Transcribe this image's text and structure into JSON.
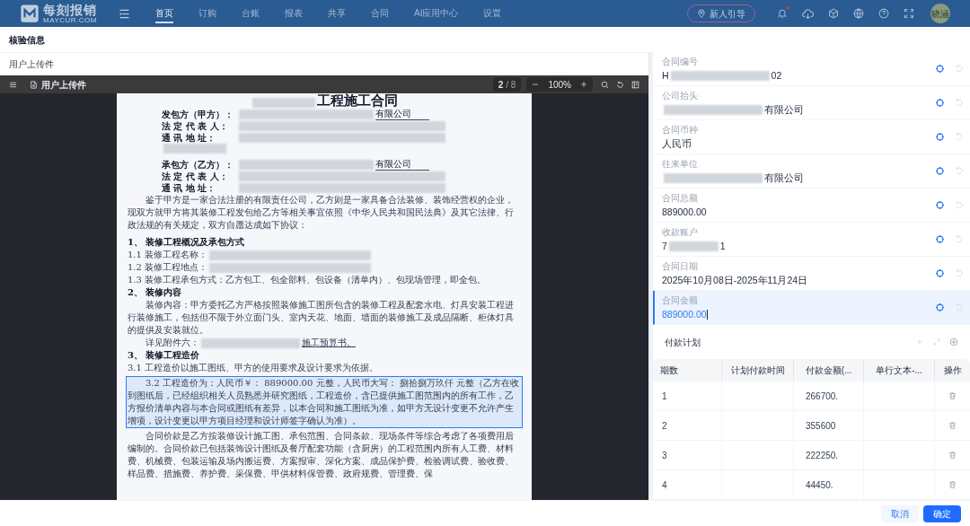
{
  "nav": {
    "logo": {
      "name": "每刻报销",
      "domain": "MAYCUR.COM"
    },
    "tabs": [
      {
        "label": "首页",
        "selected": true
      },
      {
        "label": "订购",
        "selected": false
      },
      {
        "label": "台账",
        "selected": false
      },
      {
        "label": "报表",
        "selected": false
      },
      {
        "label": "共享",
        "selected": false
      },
      {
        "label": "合同",
        "selected": false
      },
      {
        "label": "AI应用中心",
        "selected": false
      },
      {
        "label": "设置",
        "selected": false
      }
    ],
    "guide_button": "新人引导",
    "notification_unread": true,
    "avatar": "晓涵"
  },
  "dialog": {
    "title": "核验信息",
    "source_label": "用户上传件",
    "viewer": {
      "file_name": "用户上传件",
      "page": "2",
      "pages": "/ 8",
      "zoom": "100%"
    },
    "document": [
      {
        "kind": "title",
        "redacted": true,
        "after": "工程施工合同"
      },
      {
        "kind": "party",
        "text": "发包方（甲方）：",
        "redacted": true,
        "after": "有限公司"
      },
      {
        "kind": "party",
        "text": "法 定 代 表 人：",
        "redacted": true
      },
      {
        "kind": "party",
        "text": "通 讯 地 址：",
        "redacted": true
      },
      {
        "kind": "party",
        "redacted": true
      },
      {
        "kind": "spacer"
      },
      {
        "kind": "party",
        "text": "承包方（乙方）：",
        "redacted": true,
        "after": "有限公司"
      },
      {
        "kind": "party",
        "text": "法 定 代 表 人：",
        "redacted": true
      },
      {
        "kind": "party",
        "text": "通 讯 地 址：",
        "redacted": true
      },
      {
        "kind": "paragraph",
        "text": "鉴于甲方是一家合法注册的有限责任公司，乙方则是一家具备合法装修、装饰经营权的企业，现双方就甲方将其装修工程发包给乙方等相关事宜依照《中华人民共和国民法典》及其它法律、行政法规的有关规定，双方自愿达成如下协议："
      },
      {
        "kind": "spacer"
      },
      {
        "kind": "heading",
        "text": "1、 装修工程概况及承包方式"
      },
      {
        "kind": "item",
        "text": "1.1 装修工程名称：",
        "redacted": true
      },
      {
        "kind": "item",
        "text": "1.2 装修工程地点：",
        "redacted": true
      },
      {
        "kind": "item",
        "text": "1.3 装修工程承包方式：乙方包工、包全部料、包设备（清单内）、包现场管理，即全包。"
      },
      {
        "kind": "heading",
        "text": "2、 装修内容"
      },
      {
        "kind": "paragraph",
        "text": "装修内容：甲方委托乙方严格按照装修施工图所包含的装修工程及配套水电、灯具安装工程进行装修施工，包括但不限于外立面门头、室内天花、地面、墙面的装修施工及成品隔断、柜体灯具的提供及安装就位。"
      },
      {
        "kind": "paragraph",
        "text": "详见附件六：",
        "redacted": true,
        "after": "施工预算书。"
      },
      {
        "kind": "heading",
        "text": "3、 装修工程造价"
      },
      {
        "kind": "item",
        "text": "3.1 工程造价以施工图纸、甲方的使用要求及设计要求为依据。"
      },
      {
        "kind": "highlight",
        "text": "3.2 工程造价为：人民币￥： 889000.00 元整，人民币大写： 捌拾捌万玖仟 元整（乙方在收到图纸后，已经组织相关人员熟悉并研究图纸，工程造价，含已提供施工图范围内的所有工作，乙方报价清单内容与本合同或图纸有差异，以本合同和施工图纸为准，如甲方无设计变更不允许产生增项，设计变更以甲方项目经理和设计师签字确认为准）。"
      },
      {
        "kind": "paragraph",
        "text": "合同价款是乙方按装修设计施工图、承包范围、合同条款、现场条件等综合考虑了各项费用后编制的。合同价款已包括装饰设计图纸及餐厅配套功能（含厨房）的工程范围内所有人工费、材料费、机械费、包装运输及场内搬运费、方案报审、深化方案、成品保护费、检验调试费、验收费、样品费、措施费、养护费、采保费、甲供材料保管费、政府规费、管理费、保"
      }
    ],
    "fields": [
      {
        "label": "合同编号",
        "value": "H",
        "value_end": "02",
        "redacted": true,
        "selected": false
      },
      {
        "label": "公司抬头",
        "value_end": "有限公司",
        "redacted": true,
        "selected": false
      },
      {
        "label": "合同币种",
        "value": "人民币",
        "redacted": false,
        "selected": false
      },
      {
        "label": "往来单位",
        "value_end": "有限公司",
        "redacted": true,
        "selected": false
      },
      {
        "label": "合同总额",
        "value": "889000.00",
        "redacted": false,
        "selected": false
      },
      {
        "label": "收款账户",
        "value": "7",
        "value_end": "1",
        "redacted": true,
        "selected": false
      },
      {
        "label": "合同日期",
        "value": "2025年10月08日-2025年11月24日",
        "redacted": false,
        "selected": false
      },
      {
        "label": "合同金额",
        "value": "889000.00",
        "redacted": false,
        "selected": true
      }
    ],
    "payment_plan": {
      "title": "付款计划",
      "columns": [
        "期数",
        "计划付款时间",
        "付款金额(...",
        "单行文本-...",
        "操作"
      ],
      "rows": [
        {
          "period": "1",
          "amount": "266700."
        },
        {
          "period": "2",
          "amount": "355600"
        },
        {
          "period": "3",
          "amount": "222250."
        },
        {
          "period": "4",
          "amount": "44450."
        }
      ]
    },
    "buttons": {
      "cancel": "取消",
      "confirm": "确定"
    }
  }
}
